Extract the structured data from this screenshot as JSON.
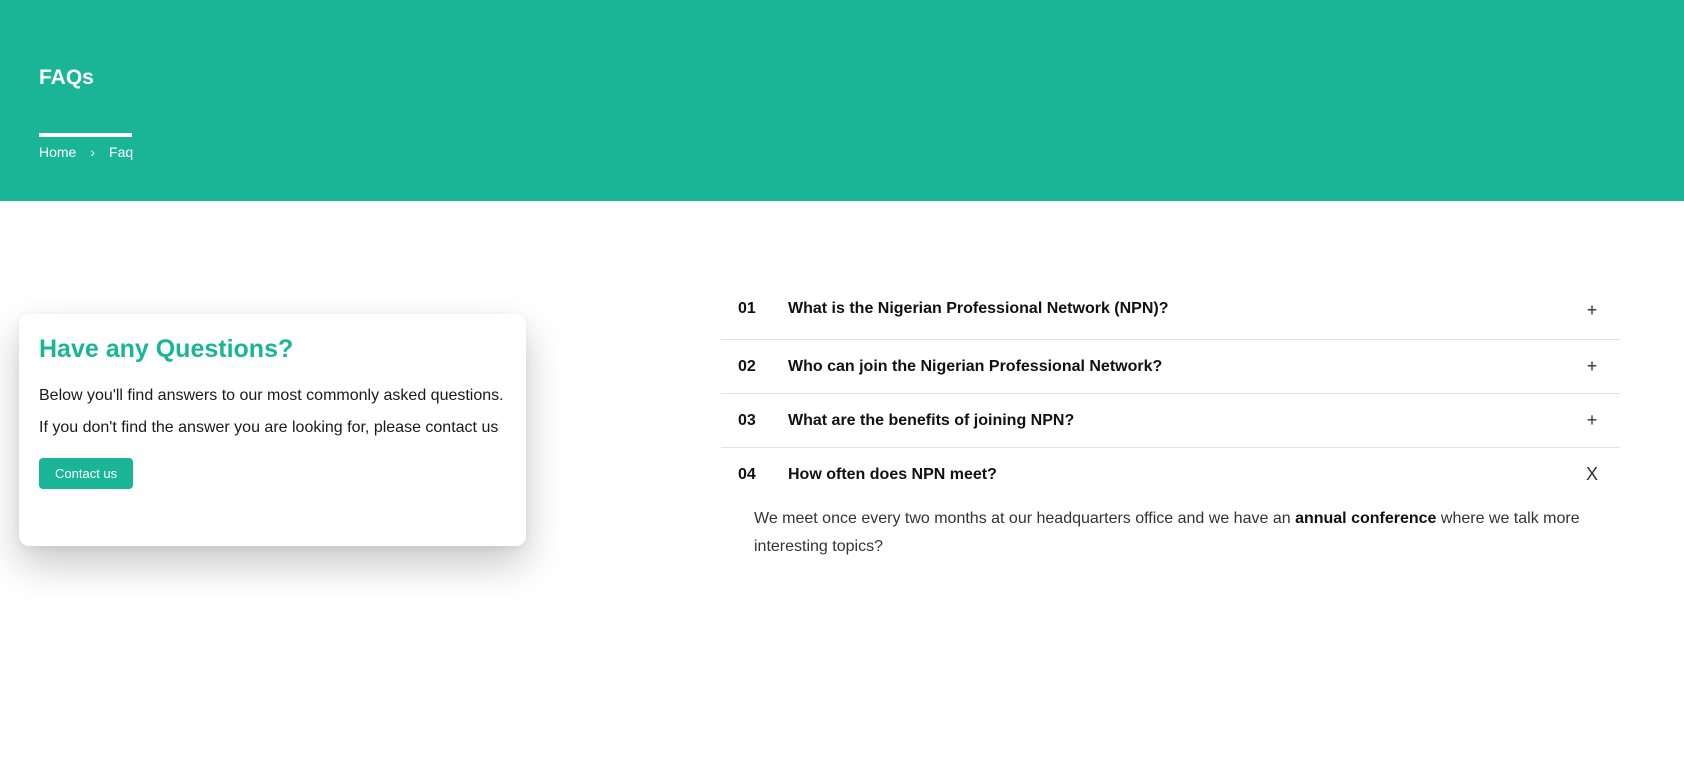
{
  "header": {
    "title": "FAQs",
    "breadcrumb": {
      "home": "Home",
      "separator": "›",
      "current": "Faq"
    }
  },
  "card": {
    "title": "Have any Questions?",
    "text": "Below you'll find answers to our most commonly asked questions. If you don't find the answer you are looking for, please contact us",
    "button_label": "Contact us"
  },
  "faqs": [
    {
      "number": "01",
      "question": "What is the Nigerian Professional Network (NPN)?",
      "toggle": "+"
    },
    {
      "number": "02",
      "question": "Who can join the Nigerian Professional Network?",
      "toggle": "+"
    },
    {
      "number": "03",
      "question": "What are the benefits of joining NPN?",
      "toggle": "+"
    },
    {
      "number": "04",
      "question": "How often does NPN meet?",
      "toggle": "X",
      "answer_before": "We meet once every two months at our headquarters office and we have an ",
      "answer_bold": "annual conference",
      "answer_after": " where we talk more interesting topics?"
    }
  ],
  "colors": {
    "accent": "#19b596"
  }
}
